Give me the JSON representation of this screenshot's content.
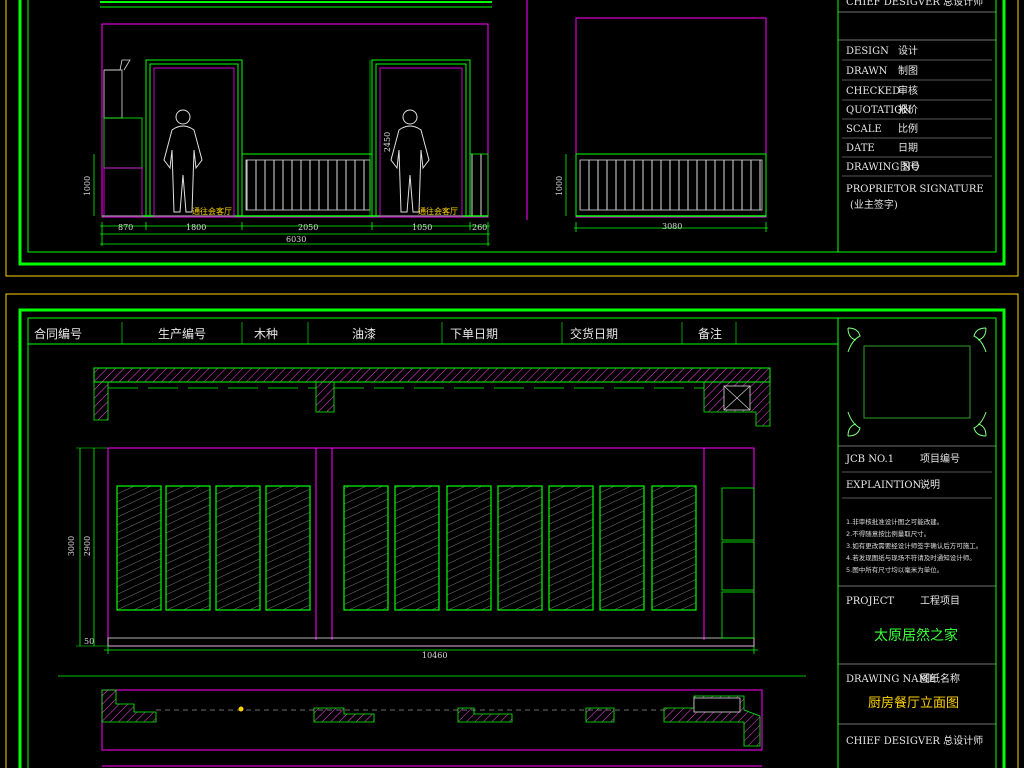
{
  "top_sheet": {
    "title_block": {
      "chief_designer": "CHIEF DESIGVER 总设计师",
      "design": "DESIGN",
      "design_cn": "设计",
      "drawn": "DRAWN",
      "drawn_cn": "制图",
      "checked": "CHECKED",
      "checked_cn": "审核",
      "quotation": "QUOTATION",
      "quotation_cn": "报价",
      "scale": "SCALE",
      "scale_cn": "比例",
      "date": "DATE",
      "date_cn": "日期",
      "drawing_no": "DRAWING NO",
      "drawing_no_cn": "图号",
      "proprietor": "PROPRIETOR SIGNATURE",
      "proprietor_cn": "(业主签字)"
    },
    "dims": {
      "d_870": "870",
      "d_1800": "1800",
      "d_2050": "2050",
      "d_1050": "1050",
      "d_260": "260",
      "total": "6030",
      "h_1000": "1000",
      "h_2450": "2450",
      "h_1000_b": "1000",
      "w_3080": "3080"
    },
    "door_labels": [
      "通往会客厅",
      "通往会客厅"
    ]
  },
  "bottom_sheet": {
    "header_row": [
      "合同编号",
      "生产编号",
      "木种",
      "油漆",
      "下单日期",
      "交货日期",
      "备注"
    ],
    "dims": {
      "width": "10460",
      "h_outer": "3000",
      "h_inner": "2900",
      "base": "50"
    },
    "title_block": {
      "job_no": "JCB NO.1",
      "job_no_cn": "项目编号",
      "explanation": "EXPLAINTION",
      "explanation_cn": "说明",
      "notes": [
        "1.非审核批准设计图之可能改建。",
        "2.不得随意按比例量取尺寸。",
        "3.如有更改需要经设计师签字确认后方可施工。",
        "4.若发现图纸与现场不符请及时通知设计师。",
        "5.图中所有尺寸均以毫米为单位。"
      ],
      "project": "PROJECT",
      "project_cn": "工程项目",
      "project_name": "太原居然之家",
      "drawing_name": "DRAWING NAME",
      "drawing_name_cn": "图纸名称",
      "drawing_title": "厨房餐厅立面图",
      "chief_designer": "CHIEF DESIGVER 总设计师"
    }
  },
  "colors": {
    "frame_yellow": "#ffd400",
    "line_green": "#00ff00",
    "line_magenta": "#ff00ff",
    "text_white": "#e6e6e6"
  }
}
